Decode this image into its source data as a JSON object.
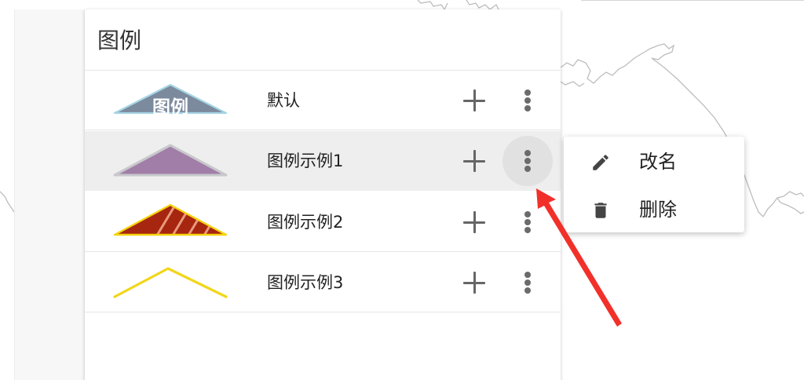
{
  "legend_panel": {
    "title": "图例"
  },
  "legend_items": [
    {
      "label": "默认",
      "swatch_text": "图例",
      "swatch_style": "default-triangle",
      "fill": "#7c8a9d",
      "stroke": "#a6d4e4"
    },
    {
      "label": "图例示例1",
      "swatch_style": "purple-triangle",
      "fill": "#a17ea8",
      "stroke": "#c8c8cc"
    },
    {
      "label": "图例示例2",
      "swatch_style": "hatched-triangle",
      "fill": "#a7260f",
      "stroke": "#f5d40f",
      "hatch": "#e89a7c"
    },
    {
      "label": "图例示例3",
      "swatch_style": "yellow-line",
      "stroke": "#f1d61a"
    }
  ],
  "row_actions": {
    "add_icon": "plus-icon",
    "more_icon": "more-vertical-icon"
  },
  "selected_index": 1,
  "context_menu": {
    "items": [
      {
        "label": "改名",
        "icon": "pencil-icon"
      },
      {
        "label": "删除",
        "icon": "trash-icon"
      }
    ]
  },
  "colors": {
    "annotation_arrow": "#f2302a",
    "selected_row": "#eeeeee",
    "icon_gray": "#666666"
  }
}
